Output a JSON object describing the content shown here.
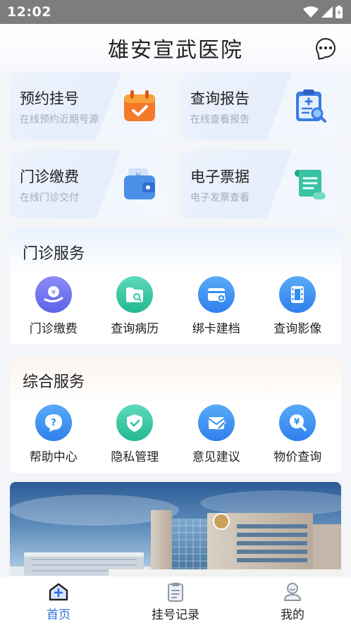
{
  "status_bar": {
    "time": "12:02"
  },
  "header": {
    "title": "雄安宣武医院",
    "chat_icon": "chat-bubble-icon"
  },
  "quick_cards": [
    {
      "title": "预约挂号",
      "subtitle": "在线预约近期号源",
      "icon": "calendar-icon",
      "color": "#f47a2a"
    },
    {
      "title": "查询报告",
      "subtitle": "在线查看报告",
      "icon": "report-clipboard-icon",
      "color": "#3b7de0"
    },
    {
      "title": "门诊缴费",
      "subtitle": "在线门诊交付",
      "icon": "wallet-icon",
      "color": "#4a8fe8"
    },
    {
      "title": "电子票据",
      "subtitle": "电子发票查看",
      "icon": "scroll-icon",
      "color": "#39c2a4"
    }
  ],
  "outpatient_services": {
    "title": "门诊服务",
    "items": [
      {
        "label": "门诊缴费",
        "icon": "yuan-hand-icon",
        "color": "#6b6ff0"
      },
      {
        "label": "查询病历",
        "icon": "folder-search-icon",
        "color": "#2fc4a0"
      },
      {
        "label": "绑卡建档",
        "icon": "card-plus-icon",
        "color": "#2f8ff0"
      },
      {
        "label": "查询影像",
        "icon": "film-icon",
        "color": "#2f8ff0"
      }
    ]
  },
  "general_services": {
    "title": "综合服务",
    "items": [
      {
        "label": "帮助中心",
        "icon": "help-icon",
        "color": "#2f8ff0"
      },
      {
        "label": "隐私管理",
        "icon": "shield-check-icon",
        "color": "#2fc4a0"
      },
      {
        "label": "意见建议",
        "icon": "mail-edit-icon",
        "color": "#2f8ff0"
      },
      {
        "label": "物价查询",
        "icon": "price-search-icon",
        "color": "#2f8ff0"
      }
    ]
  },
  "bottom_nav": [
    {
      "label": "首页",
      "icon": "home-plus-icon",
      "active": true
    },
    {
      "label": "挂号记录",
      "icon": "clipboard-list-icon",
      "active": false
    },
    {
      "label": "我的",
      "icon": "user-icon",
      "active": false
    }
  ],
  "colors": {
    "accent": "#2f6fdf"
  }
}
